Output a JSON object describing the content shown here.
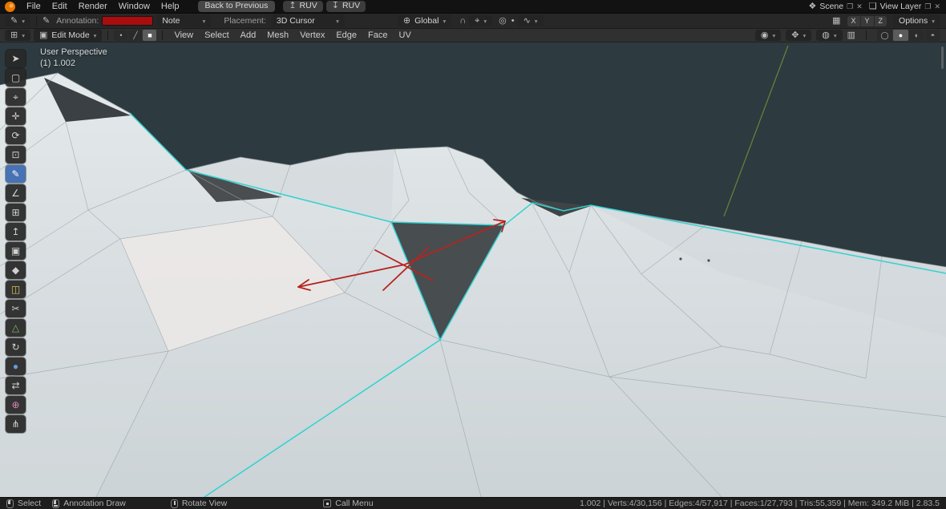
{
  "icons": {
    "chevron-down": "▾",
    "annotate": "✎",
    "orientation": "⊕",
    "magnet": "∩",
    "snap": "⌖",
    "proportional": "◎",
    "prop-dot": "•",
    "falloff": "∿",
    "grid": "▦",
    "editor-type": "⊞",
    "mode": "▣",
    "visibility": "◉",
    "gizmo": "✥",
    "overlays": "◍",
    "xray": "▥",
    "shade-wire": "◯",
    "shade-solid": "●",
    "shade-material": "◐",
    "shade-render": "◓",
    "copy": "❐",
    "close": "✕"
  },
  "topbar": {
    "menus": [
      "File",
      "Edit",
      "Render",
      "Window",
      "Help"
    ],
    "back_button": "Back to Previous",
    "keymap_buttons": [
      {
        "glyph": "↥",
        "label": "RUV"
      },
      {
        "glyph": "↧",
        "label": "RUV"
      }
    ],
    "scene": {
      "icon": "❖",
      "label": "Scene"
    },
    "view_layer": {
      "icon": "❏",
      "label": "View Layer"
    }
  },
  "tool_settings": {
    "annotation_label": "Annotation:",
    "color_hex": "#a90d0d",
    "note_value": "Note",
    "placement_label": "Placement:",
    "placement_value": "3D Cursor",
    "orientation_value": "Global",
    "mirror_axes": [
      "X",
      "Y",
      "Z"
    ],
    "options_label": "Options"
  },
  "viewport_header": {
    "mode": "Edit Mode",
    "select_modes": [
      {
        "name": "vertex",
        "glyph": "•",
        "active": false
      },
      {
        "name": "edge",
        "glyph": "╱",
        "active": false
      },
      {
        "name": "face",
        "glyph": "■",
        "active": true
      }
    ],
    "menus": [
      "View",
      "Select",
      "Add",
      "Mesh",
      "Vertex",
      "Edge",
      "Face",
      "UV"
    ]
  },
  "toolbar": {
    "tools": [
      {
        "name": "tweak",
        "glyph": "➤"
      },
      {
        "name": "select-box",
        "glyph": "▢"
      },
      {
        "name": "cursor",
        "glyph": "⌖"
      },
      {
        "name": "move",
        "glyph": "✛"
      },
      {
        "name": "rotate",
        "glyph": "⟳"
      },
      {
        "name": "scale",
        "glyph": "⊡"
      },
      {
        "name": "annotate",
        "glyph": "✎",
        "active": true
      },
      {
        "name": "measure",
        "glyph": "∠"
      },
      {
        "name": "add-cube",
        "glyph": "⊞"
      },
      {
        "name": "extrude-region",
        "glyph": "↥"
      },
      {
        "name": "inset-faces",
        "glyph": "▣"
      },
      {
        "name": "bevel",
        "glyph": "◆"
      },
      {
        "name": "loop-cut",
        "glyph": "◫",
        "tint": "#d8c353"
      },
      {
        "name": "knife",
        "glyph": "✂"
      },
      {
        "name": "poly-build",
        "glyph": "△",
        "tint": "#7fbf5f"
      },
      {
        "name": "spin",
        "glyph": "↻"
      },
      {
        "name": "smooth",
        "glyph": "●",
        "tint": "#5f9fd8"
      },
      {
        "name": "edge-slide",
        "glyph": "⇄"
      },
      {
        "name": "shrink-fatten",
        "glyph": "⊕",
        "tint": "#d884b8"
      },
      {
        "name": "rip-region",
        "glyph": "⋔"
      }
    ]
  },
  "viewport": {
    "overlay_title": "User Perspective",
    "overlay_subtitle": "(1) 1.002",
    "background": "#2d3a3f",
    "mesh_color": "#dde3e6",
    "sharp_edge_color": "#33d1d1",
    "annotation_color": "#b62420",
    "axis_y_color": "#6b7d3c"
  },
  "statusbar": {
    "hints": [
      {
        "icon": "mouse-left",
        "label": "Select"
      },
      {
        "icon": "mouse-drag",
        "label": "Annotation Draw"
      },
      {
        "icon": "mouse-middle",
        "label": "Rotate View"
      },
      {
        "icon": "key",
        "label": "Call Menu"
      }
    ],
    "stats": "1.002 | Verts:4/30,156 | Edges:4/57,917 | Faces:1/27,793 | Tris:55,359 | Mem: 349.2 MiB | 2.83.5"
  }
}
